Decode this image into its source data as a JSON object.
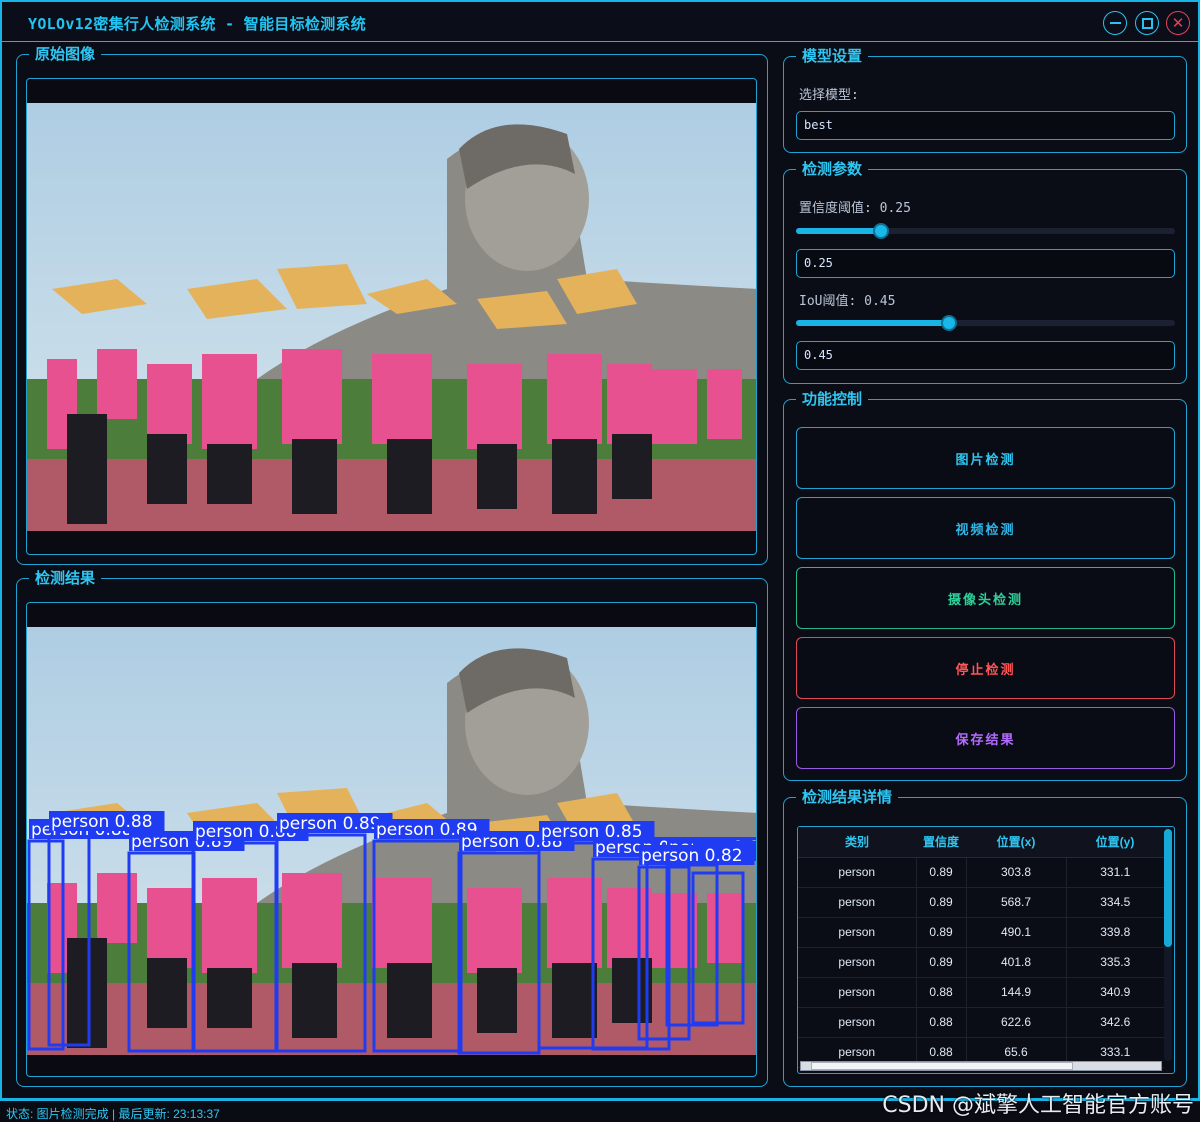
{
  "window": {
    "title": "YOLOv12密集行人检测系统 - 智能目标检测系统"
  },
  "panels": {
    "original_label": "原始图像",
    "result_label": "检测结果"
  },
  "model": {
    "group_label": "模型设置",
    "select_label": "选择模型:",
    "selected": "best"
  },
  "params": {
    "group_label": "检测参数",
    "conf_label": "置信度阈值: 0.25",
    "conf_value": "0.25",
    "conf_fraction": 0.25,
    "iou_label": "IoU阈值: 0.45",
    "iou_value": "0.45",
    "iou_fraction": 0.45
  },
  "controls": {
    "group_label": "功能控制",
    "image_btn": "图片检测",
    "video_btn": "视频检测",
    "camera_btn": "摄像头检测",
    "stop_btn": "停止检测",
    "save_btn": "保存结果"
  },
  "colors": {
    "accent": "#18b4e6",
    "image_btn": "#2fc6f2",
    "video_btn": "#2fb5e6",
    "camera_btn": "#2fd19a",
    "stop_btn": "#ff5555",
    "save_btn": "#b46bff",
    "box": "#1f3cf2"
  },
  "results": {
    "group_label": "检测结果详情",
    "columns": [
      "类别",
      "置信度",
      "位置(x)",
      "位置(y)"
    ],
    "rows": [
      [
        "person",
        "0.89",
        "303.8",
        "331.1"
      ],
      [
        "person",
        "0.89",
        "568.7",
        "334.5"
      ],
      [
        "person",
        "0.89",
        "490.1",
        "339.8"
      ],
      [
        "person",
        "0.89",
        "401.8",
        "335.3"
      ],
      [
        "person",
        "0.88",
        "144.9",
        "340.9"
      ],
      [
        "person",
        "0.88",
        "622.6",
        "342.6"
      ],
      [
        "person",
        "0.88",
        "65.6",
        "333.1"
      ]
    ]
  },
  "detections": {
    "labels": [
      "person 0.88",
      "person 0.88",
      "person 0.89",
      "person 0.88",
      "person 0.89",
      "person 0.89",
      "person 0.88",
      "person 0.85",
      "person 0.89",
      "person 0.88",
      "person 0.89",
      "person 0.82"
    ]
  },
  "statusbar": {
    "text": "状态: 图片检测完成 | 最后更新: 23:13:37",
    "watermark": "CSDN @斌擎人工智能官方账号"
  }
}
